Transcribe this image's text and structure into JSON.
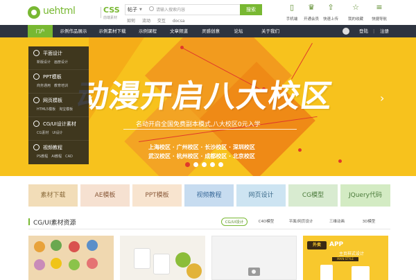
{
  "header": {
    "logo_text": "uehtml",
    "logo_css": "CSS",
    "logo_sub": "前端素材",
    "search": {
      "type": "帖子",
      "placeholder": "请输入搜索内容",
      "button": "搜索",
      "hot": [
        "如何",
        "流动",
        "交互",
        "docsa"
      ]
    },
    "tools": [
      {
        "icon": "mobile-icon",
        "label": "手机端"
      },
      {
        "icon": "crown-icon",
        "label": "开通会员"
      },
      {
        "icon": "upload-icon",
        "label": "快速上传"
      },
      {
        "icon": "star-icon",
        "label": "我的收藏"
      },
      {
        "icon": "menu-icon",
        "label": "快捷导航"
      }
    ]
  },
  "nav": {
    "items": [
      "门户",
      "示例作品展示",
      "示例素材下载",
      "示例课程",
      "文章频道",
      "灵感创意",
      "论坛",
      "关于我们"
    ],
    "login": "登陆",
    "register": "注册"
  },
  "menu": [
    {
      "title": "平面设计",
      "subs": [
        "新版设计",
        "画册设计"
      ]
    },
    {
      "title": "PPT模板",
      "subs": [
        "商务通用",
        "教育培训"
      ]
    },
    {
      "title": "网页模板",
      "subs": [
        "HTML5模板",
        "淘宝模板"
      ]
    },
    {
      "title": "CG/UI设计素材",
      "subs": [
        "CG素材",
        "UI设计"
      ]
    },
    {
      "title": "视频教程",
      "subs": [
        "PS教程",
        "AI教程",
        "CAD"
      ]
    }
  ],
  "banner": {
    "headline": "动漫开启八大校区",
    "subtitle": "名动开启全国免费副本模式,八大校区0元入学",
    "campus_row1": "上海校区 · 广州校区 · 长沙校区 · 深圳校区",
    "campus_row2": "武汉校区 · 杭州校区 · 成都校区 · 北京校区",
    "slide_count": 5,
    "active_slide": 0,
    "prev": "‹",
    "next": "›"
  },
  "tags": [
    {
      "label": "素材下载",
      "bg": "#f2ddb8",
      "color": "#8a6a3a"
    },
    {
      "label": "AE模板",
      "bg": "#f6e1d1",
      "color": "#8a5a3a"
    },
    {
      "label": "PPT模板",
      "bg": "#f8e4cf",
      "color": "#8a5a3a"
    },
    {
      "label": "视频教程",
      "bg": "#c7dcf0",
      "color": "#3a6a9a"
    },
    {
      "label": "网页设计",
      "bg": "#cde4f2",
      "color": "#3a6a8a"
    },
    {
      "label": "CG模型",
      "bg": "#d8ebd0",
      "color": "#4a7a3a"
    },
    {
      "label": "JQuery代码",
      "bg": "#d3ebc3",
      "color": "#4a7a3a"
    }
  ],
  "section": {
    "title": "CG/UI素材资源",
    "tabs": [
      "CG/UI设计",
      "C4D模型",
      "平面/网页设计",
      "三维动画",
      "3D模型"
    ],
    "active_tab": 0
  },
  "app_card": {
    "badge": "外卖",
    "title": "APP",
    "subtitle": "主页样式设计",
    "tag": "MAIN STYLE DESIGN"
  },
  "colors": {
    "accent": "#78b832",
    "nav_bg": "#2e3440",
    "banner_bg": "#f7c21d",
    "banner_red": "#e0392b"
  }
}
